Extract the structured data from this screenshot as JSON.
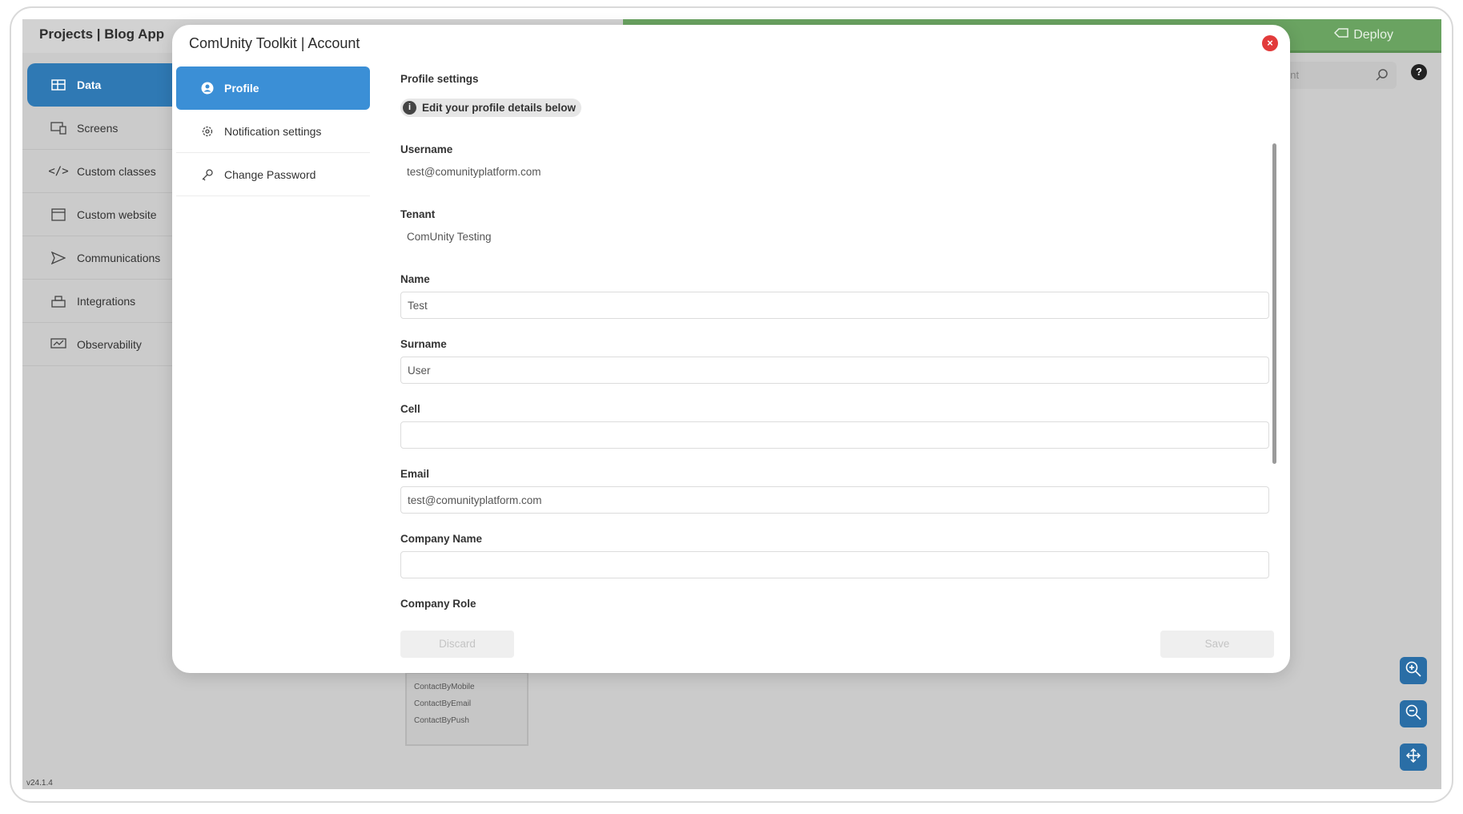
{
  "app": {
    "title": "Projects | Blog App",
    "deploy_label": "Deploy",
    "search_placeholder": "ent",
    "help_label": "?",
    "version": "v24.1.4"
  },
  "sidebar": {
    "items": [
      {
        "label": "Data",
        "icon": "table-icon",
        "active": true
      },
      {
        "label": "Screens",
        "icon": "screens-icon"
      },
      {
        "label": "Custom classes",
        "icon": "code-icon"
      },
      {
        "label": "Custom website",
        "icon": "browser-icon"
      },
      {
        "label": "Communications",
        "icon": "send-icon"
      },
      {
        "label": "Integrations",
        "icon": "integrations-icon"
      },
      {
        "label": "Observability",
        "icon": "observability-icon"
      }
    ]
  },
  "canvas": {
    "entity_fields": [
      "ContactByMobile",
      "ContactByEmail",
      "ContactByPush"
    ]
  },
  "modal": {
    "title": "ComUnity Toolkit | Account",
    "close_label": "×",
    "tabs": [
      {
        "label": "Profile",
        "icon": "user-circle-icon",
        "active": true
      },
      {
        "label": "Notification settings",
        "icon": "gear-icon"
      },
      {
        "label": "Change Password",
        "icon": "key-icon"
      }
    ],
    "section_title": "Profile settings",
    "info_text": "Edit your profile details below",
    "fields": {
      "username": {
        "label": "Username",
        "value": "test@comunityplatform.com"
      },
      "tenant": {
        "label": "Tenant",
        "value": "ComUnity Testing"
      },
      "name": {
        "label": "Name",
        "value": "Test"
      },
      "surname": {
        "label": "Surname",
        "value": "User"
      },
      "cell": {
        "label": "Cell",
        "value": ""
      },
      "email": {
        "label": "Email",
        "value": "test@comunityplatform.com"
      },
      "company_name": {
        "label": "Company Name",
        "value": ""
      },
      "company_role": {
        "label": "Company Role"
      }
    },
    "discard_label": "Discard",
    "save_label": "Save"
  },
  "colors": {
    "accent_blue": "#3b8fd6",
    "sidebar_active": "#2f79b4",
    "deploy_green": "#6aa361",
    "close_red": "#e23b3b"
  }
}
